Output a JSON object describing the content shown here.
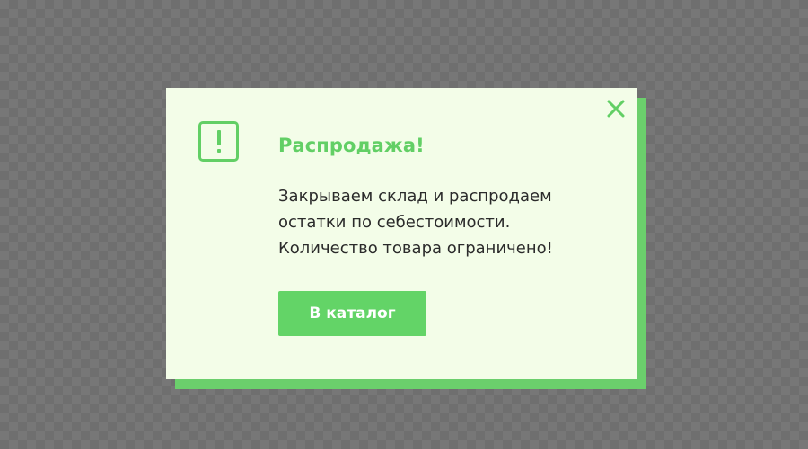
{
  "modal": {
    "title": "Распродажа!",
    "message_lines": [
      "Закрываем склад и распродаем",
      "остатки по себестоимости.",
      "Количество товара ограничено!"
    ],
    "button_label": "В каталог",
    "icons": {
      "alert": "exclamation-icon",
      "close": "close-icon"
    }
  },
  "colors": {
    "accent": "#62cf65",
    "button": "#63d467",
    "modal_background": "#f3fde8",
    "shadow": "#6bcf6c",
    "overlay": "#777777",
    "text": "#2b2b2b"
  }
}
